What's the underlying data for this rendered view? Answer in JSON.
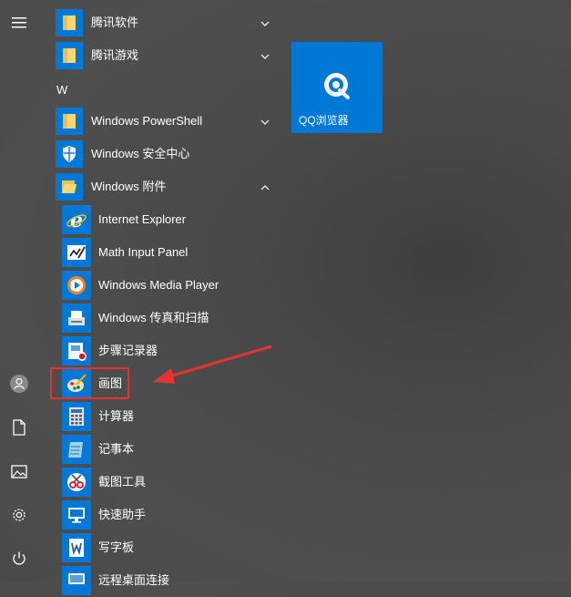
{
  "rail": {
    "items": [
      "menu-icon",
      "user-icon",
      "document-icon",
      "pictures-icon",
      "settings-icon",
      "power-icon"
    ]
  },
  "app_list": {
    "groups": [
      {
        "label": "腾讯软件",
        "expanded": false
      },
      {
        "label": "腾讯游戏",
        "expanded": false
      }
    ],
    "letter_header": "W",
    "w_items": [
      {
        "label": "Windows PowerShell",
        "type": "folder",
        "expanded": false
      },
      {
        "label": "Windows 安全中心",
        "type": "app"
      },
      {
        "label": "Windows 附件",
        "type": "folder",
        "expanded": true
      }
    ],
    "accessories": [
      {
        "label": "Internet Explorer",
        "icon": "internet-explorer-icon"
      },
      {
        "label": "Math Input Panel",
        "icon": "math-input-panel-icon"
      },
      {
        "label": "Windows Media Player",
        "icon": "media-player-icon"
      },
      {
        "label": "Windows 传真和扫描",
        "icon": "fax-scan-icon"
      },
      {
        "label": "步骤记录器",
        "icon": "steps-recorder-icon"
      },
      {
        "label": "画图",
        "icon": "paint-icon"
      },
      {
        "label": "计算器",
        "icon": "calculator-icon"
      },
      {
        "label": "记事本",
        "icon": "notepad-icon"
      },
      {
        "label": "截图工具",
        "icon": "snipping-tool-icon"
      },
      {
        "label": "快速助手",
        "icon": "quick-assist-icon"
      },
      {
        "label": "写字板",
        "icon": "wordpad-icon"
      },
      {
        "label": "远程桌面连接",
        "icon": "remote-desktop-icon"
      }
    ]
  },
  "tiles": [
    {
      "label": "QQ浏览器",
      "icon": "qq-browser-icon"
    }
  ],
  "colors": {
    "accent": "#0078d7",
    "folder": "#f7d774",
    "annotation": "#e5342f"
  }
}
